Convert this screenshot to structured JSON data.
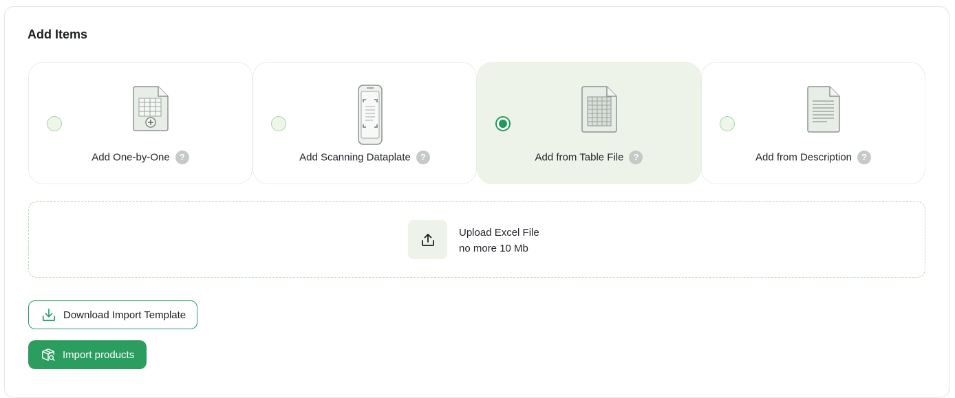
{
  "section": {
    "title": "Add Items"
  },
  "options": [
    {
      "label": "Add One-by-One",
      "icon": "spreadsheet-plus-icon",
      "selected": false,
      "help": "?"
    },
    {
      "label": "Add Scanning Dataplate",
      "icon": "phone-scan-icon",
      "selected": false,
      "help": "?"
    },
    {
      "label": "Add from Table File",
      "icon": "table-file-icon",
      "selected": true,
      "help": "?"
    },
    {
      "label": "Add from Description",
      "icon": "text-document-icon",
      "selected": false,
      "help": "?"
    }
  ],
  "upload": {
    "title": "Upload Excel File",
    "limit": "no more 10 Mb",
    "icon": "upload-icon"
  },
  "buttons": {
    "download_template": "Download Import Template",
    "import_products": "Import products"
  },
  "colors": {
    "accent": "#2a9d5f",
    "selected_bg": "#eef3ea",
    "dashed_border": "#b6dcb0"
  }
}
